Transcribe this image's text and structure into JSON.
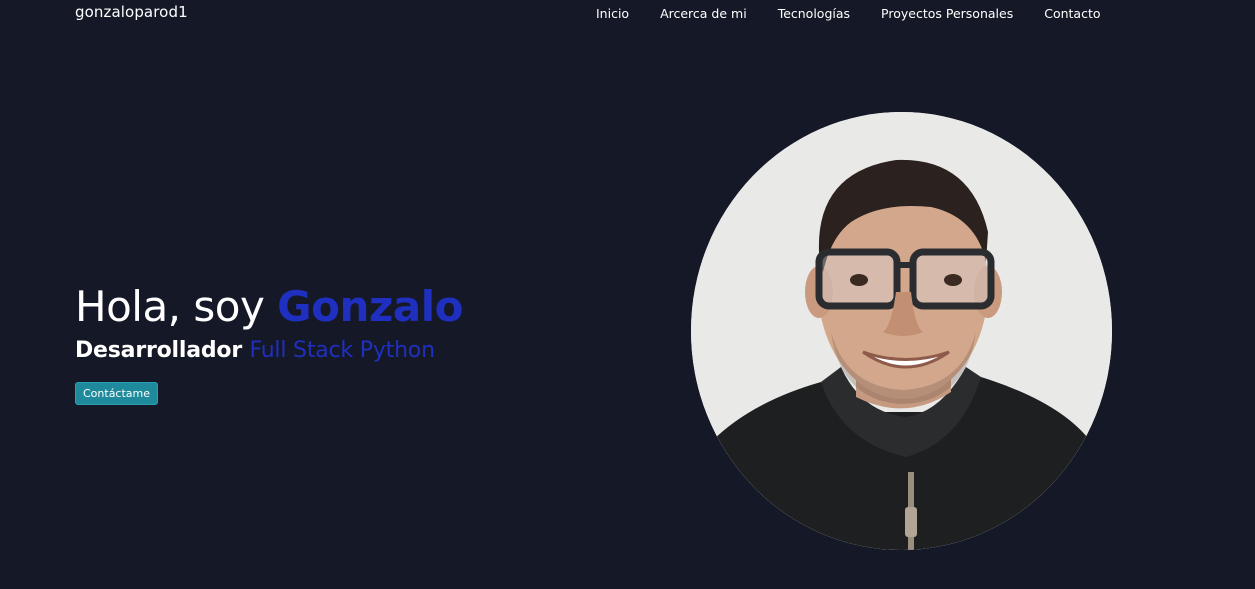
{
  "header": {
    "brand": "gonzaloparod1",
    "nav": [
      {
        "label": "Inicio"
      },
      {
        "label": "Arcerca de mi"
      },
      {
        "label": "Tecnologías"
      },
      {
        "label": "Proyectos Personales"
      },
      {
        "label": "Contacto"
      }
    ]
  },
  "hero": {
    "greeting": "Hola, soy ",
    "name": "Gonzalo",
    "role_prefix": "Desarrollador ",
    "role_highlight": "Full Stack Python",
    "cta_label": "Contáctame"
  },
  "colors": {
    "background": "#151927",
    "accent": "#1f2fbf",
    "button": "#1f8a9c"
  }
}
